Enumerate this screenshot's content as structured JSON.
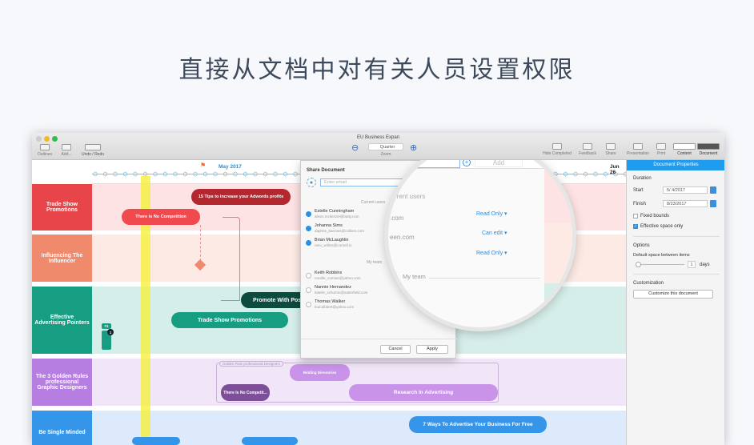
{
  "headline": "直接从文档中对有关人员设置权限",
  "window": {
    "title": "EU Business Expan"
  },
  "toolbar": {
    "outlines": "Outlines",
    "add": "Add...",
    "undo_redo": "Undo / Redo",
    "zoom_value": "Quarter",
    "zoom_label": "Zoom",
    "hide_completed": "Hide Completed",
    "feedback": "Feedback",
    "share": "Share",
    "presentation": "Presentation",
    "print": "Print",
    "content": "Content",
    "document": "Document"
  },
  "timeline": {
    "month1": "May 2017",
    "month2": "Jun 26"
  },
  "rows": [
    {
      "label": "Trade Show Promotions",
      "color": "#e8454b"
    },
    {
      "label": "Influencing The Influencer",
      "color": "#f08a6c"
    },
    {
      "label": "Effective Advertising Pointers",
      "color": "#179e82"
    },
    {
      "label": "The 3 Golden Rules professional Graphic Designers",
      "color": "#b67ee0"
    },
    {
      "label": "Be Single Minded",
      "color": "#3595e8"
    }
  ],
  "tasks": {
    "t1": "15 Tips to increase your Adwords profits",
    "t2": "There is No Competition",
    "t3": "Promote With Pos",
    "t4": "Trade Show Promotions",
    "badge": "#1",
    "badge_count": "1",
    "group": "Golden Rule professional Designers",
    "t5": "Bidding Directories",
    "t6": "There Is No Competit...",
    "t7": "Research In Advertising",
    "t8": "7 Ways To Advertise Your Business For Free"
  },
  "share": {
    "title": "Share Document",
    "email_placeholder": "Enter email",
    "current_users": "Current users",
    "my_team": "My team",
    "cancel": "Cancel",
    "apply": "Apply",
    "add": "Add",
    "current": [
      {
        "name": "Estelle Cunningham",
        "email": "alexis.mckenzie@batty.com"
      },
      {
        "name": "Johanna Sims",
        "email": "daphne_barrows@collsen.com"
      },
      {
        "name": "Brian McLaughlin",
        "email": "nero_willms@cornell.io"
      }
    ],
    "team": [
      {
        "name": "Keith Robbins",
        "email": "norelle_cormier@yahoo.com"
      },
      {
        "name": "Nannie Hernandez",
        "email": "katelin_schumm@satterfield.com"
      },
      {
        "name": "Thomas Walker",
        "email": "bud.dibbert@yahoo.com"
      }
    ]
  },
  "magnifier": {
    "current_users": "rrent users",
    "email1": ".com",
    "email2": "een.com",
    "perm1": "Read Only",
    "perm2": "Can edit",
    "perm3": "Read Only",
    "my_team": "My team"
  },
  "panel": {
    "title": "Document Properties",
    "duration": "Duration",
    "start_label": "Start",
    "start": "5/  4/2017",
    "finish_label": "Finish",
    "finish": "8/23/2017",
    "fixed_bounds": "Fixed bounds",
    "effective": "Effective space only",
    "options": "Options",
    "default_space": "Default space between items",
    "days_value": "1",
    "days": "days",
    "customization": "Customization",
    "customize_btn": "Customize this document"
  }
}
